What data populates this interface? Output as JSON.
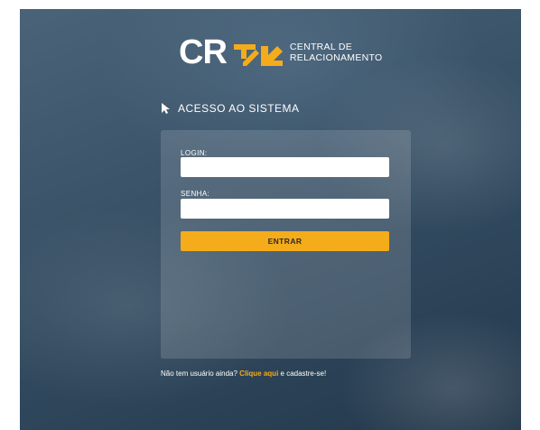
{
  "logo": {
    "abbreviation": "CR",
    "line1": "CENTRAL DE",
    "line2": "RELACIONAMENTO",
    "mark_icon": "double-arrow-logo-icon"
  },
  "section": {
    "title": "ACESSO AO SISTEMA",
    "icon": "cursor-arrow-icon"
  },
  "form": {
    "login_label": "LOGIN:",
    "login_value": "",
    "password_label": "SENHA:",
    "password_value": "",
    "submit_label": "ENTRAR"
  },
  "signup": {
    "prefix": "Não tem usuário ainda? ",
    "link": "Clique aqui",
    "suffix": " e cadastre-se!"
  },
  "colors": {
    "accent": "#f5ac1a",
    "background": "#34506a",
    "text": "#ffffff"
  }
}
